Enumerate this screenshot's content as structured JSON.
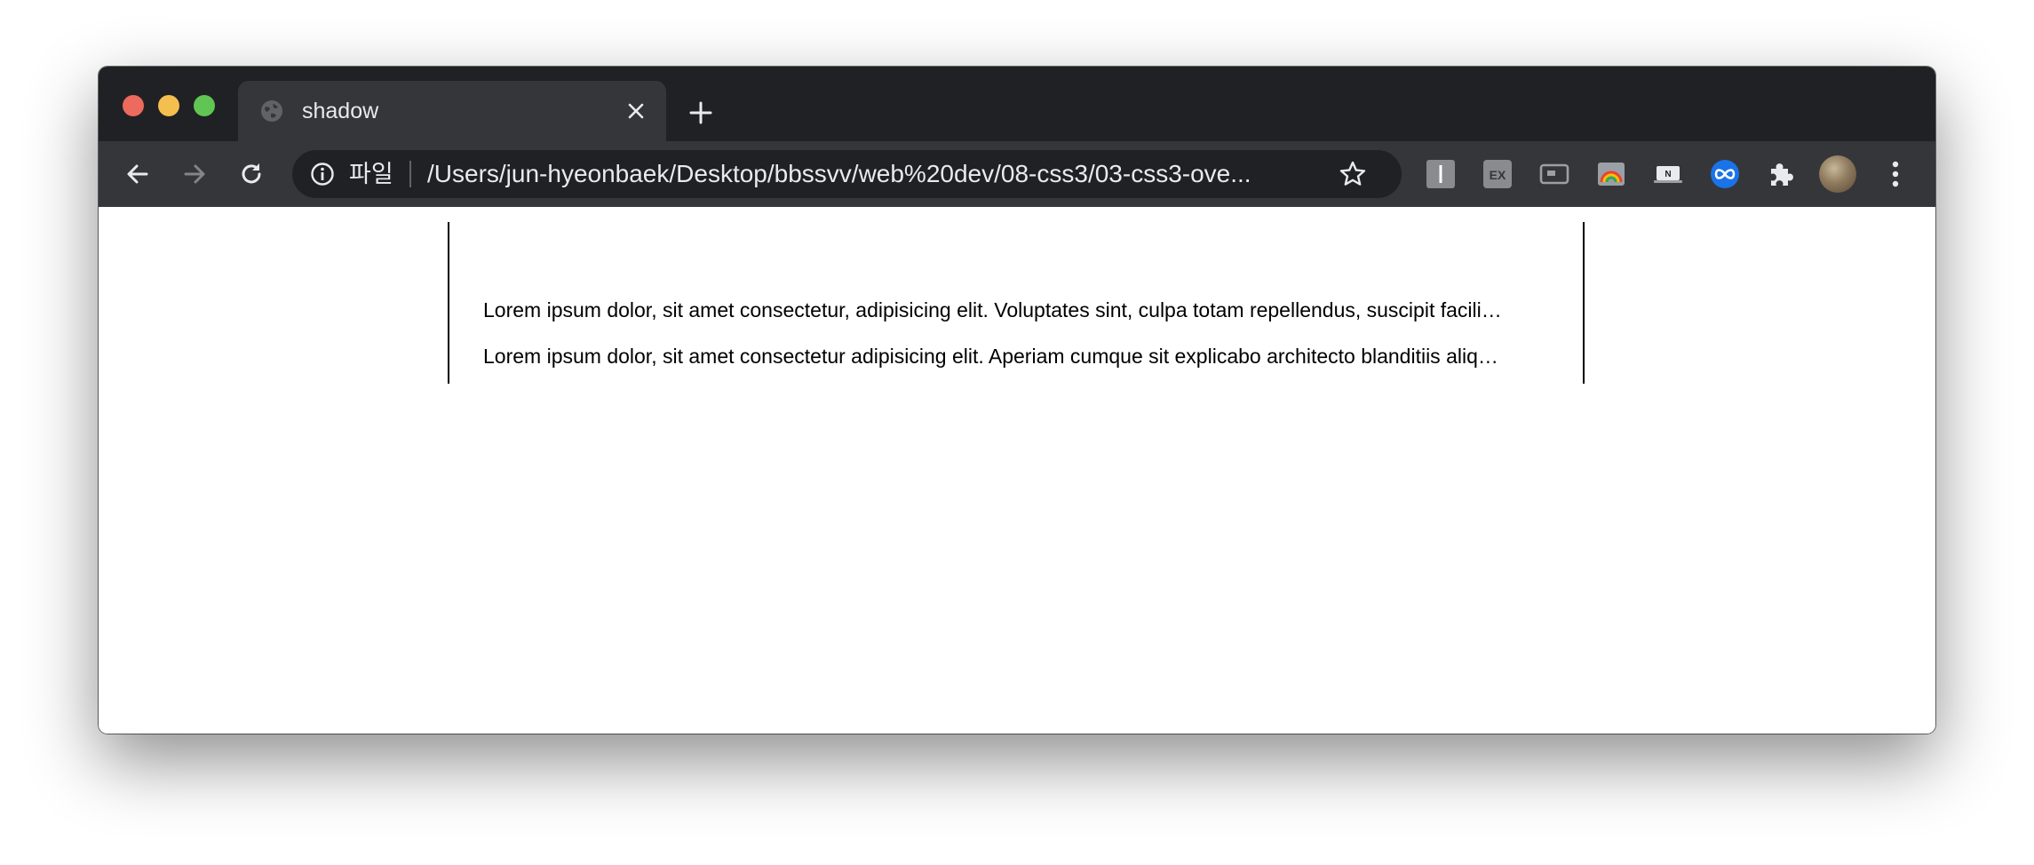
{
  "window": {
    "traffic_lights": [
      "close",
      "minimize",
      "maximize"
    ]
  },
  "tab": {
    "title": "shadow",
    "favicon": "globe-icon",
    "close_icon": "close-icon"
  },
  "new_tab_icon": "plus-icon",
  "toolbar": {
    "back_icon": "back-arrow-icon",
    "forward_icon": "forward-arrow-icon",
    "reload_icon": "reload-icon",
    "omnibox": {
      "info_icon": "info-icon",
      "scheme_label": "파일",
      "url": "/Users/jun-hyeonbaek/Desktop/bbssvv/web%20dev/08-css3/03-css3-ove...",
      "bookmark_icon": "star-icon"
    },
    "extensions": [
      "text-cursor-extension-icon",
      "ex-extension-icon",
      "window-extension-icon",
      "rainbow-extension-icon",
      "notion-extension-icon",
      "infinity-extension-icon",
      "puzzle-icon"
    ],
    "menu_icon": "kebab-menu-icon"
  },
  "page": {
    "paragraphs": [
      "Lorem ipsum dolor, sit amet consectetur, adipisicing elit. Voluptates sint, culpa totam repellendus, suscipit facili…",
      "Lorem ipsum dolor, sit amet consectetur adipisicing elit. Aperiam cumque sit explicabo architecto blanditiis aliq…"
    ]
  },
  "colors": {
    "tabstrip": "#202124",
    "toolbar": "#35363a",
    "omnibox": "#202124",
    "text_light": "#e8eaed",
    "close": "#ed6a5e",
    "minimize": "#f5bf4f",
    "maximize": "#61c554",
    "accent_blue": "#1a73e8"
  }
}
